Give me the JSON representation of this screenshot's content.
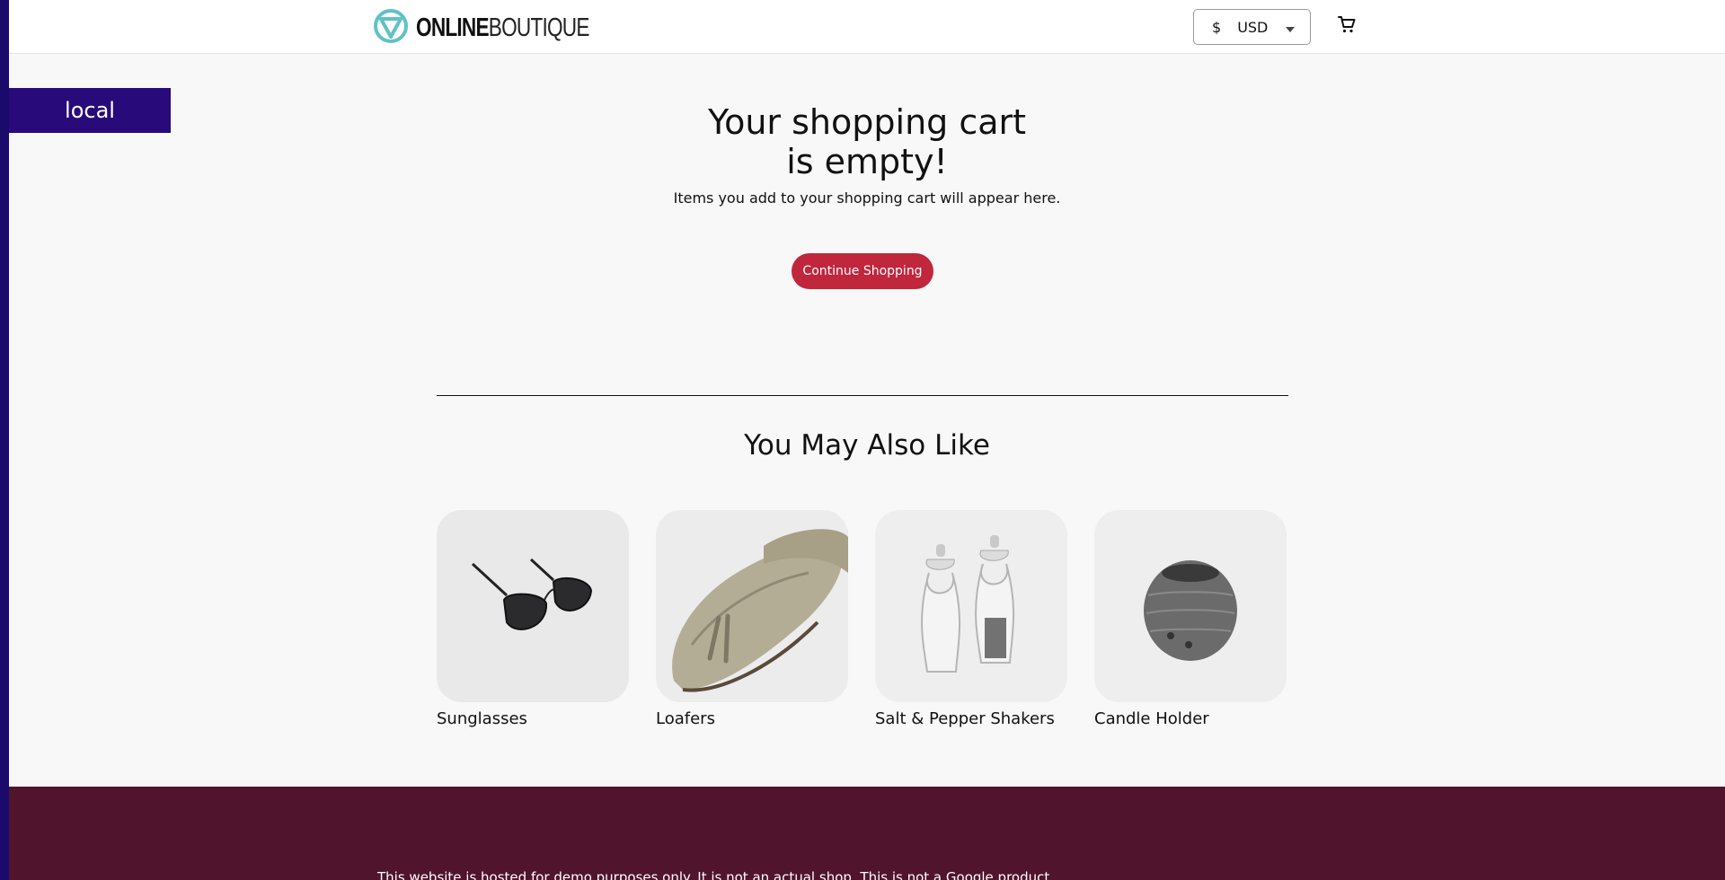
{
  "environment": {
    "label": "local"
  },
  "header": {
    "logo_bold": "ONLINE",
    "logo_light": "BOUTIQUE",
    "currency": {
      "symbol": "$",
      "code": "USD"
    }
  },
  "cart": {
    "empty_title": "Your shopping cart is empty!",
    "empty_subtitle": "Items you add to your shopping cart will appear here.",
    "continue_label": "Continue Shopping"
  },
  "recommendations": {
    "title": "You May Also Like",
    "items": [
      {
        "name": "Sunglasses",
        "image": "sunglasses"
      },
      {
        "name": "Loafers",
        "image": "loafers"
      },
      {
        "name": "Salt & Pepper Shakers",
        "image": "salt-pepper-shakers"
      },
      {
        "name": "Candle Holder",
        "image": "candle-holder"
      }
    ]
  },
  "footer": {
    "text": "This website is hosted for demo purposes only. It is not an actual shop. This is not a Google product."
  },
  "colors": {
    "accent": "#c0263c",
    "footer_bg": "#50142c",
    "env_badge": "#290a7a"
  }
}
